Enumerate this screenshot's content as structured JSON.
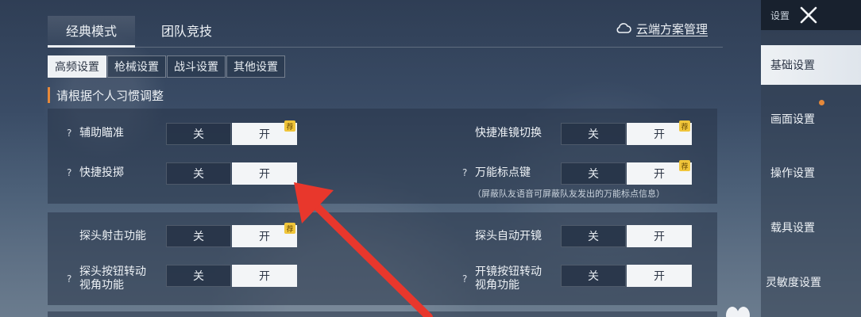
{
  "mode_tabs": [
    {
      "label": "经典模式",
      "active": true
    },
    {
      "label": "团队竞技",
      "active": false
    }
  ],
  "cloud_link": {
    "label": "云端方案管理",
    "icon": "cloud-icon"
  },
  "sub_tabs": [
    {
      "label": "高频设置",
      "active": true
    },
    {
      "label": "枪械设置",
      "active": false
    },
    {
      "label": "战斗设置",
      "active": false
    },
    {
      "label": "其他设置",
      "active": false
    }
  ],
  "section_title": "请根据个人习惯调整",
  "toggle_labels": {
    "off": "关",
    "on": "开",
    "badge": "荐"
  },
  "panel1": {
    "aim_assist": {
      "label": "辅助瞄准",
      "help": "?",
      "value": "开",
      "recommended": true
    },
    "quick_scope_switch": {
      "label": "快捷准镜切换",
      "value": "开",
      "recommended": true
    },
    "quick_throw": {
      "label": "快捷投掷",
      "help": "?",
      "value": "开"
    },
    "universal_marker": {
      "label": "万能标点键",
      "help": "?",
      "value": "开",
      "recommended": true,
      "hint": "（屏蔽队友语音可屏蔽队友发出的万能标点信息）"
    }
  },
  "panel2": {
    "peek_fire": {
      "label": "探头射击功能",
      "value": "开",
      "recommended": true
    },
    "peek_auto_scope": {
      "label": "探头自动开镜",
      "value": "开"
    },
    "peek_button_rotate": {
      "label_line1": "探头按钮转动",
      "label_line2": "视角功能",
      "help": "?",
      "value": "开"
    },
    "scope_button_rotate": {
      "label_line1": "开镜按钮转动",
      "label_line2": "视角功能",
      "help": "?",
      "value": "开"
    }
  },
  "sidebar": {
    "top_label": "设置",
    "close_icon": "close-icon",
    "items": [
      {
        "label": "基础设置",
        "active": true
      },
      {
        "label": "画面设置",
        "active": false,
        "notification": true
      },
      {
        "label": "操作设置",
        "active": false
      },
      {
        "label": "载具设置",
        "active": false
      },
      {
        "label": "灵敏度设置",
        "active": false
      }
    ]
  },
  "colors": {
    "accent": "#e6893a",
    "badge": "#f0c53a",
    "arrow": "#e8372c",
    "toggle_on": "#f3f5f7"
  }
}
